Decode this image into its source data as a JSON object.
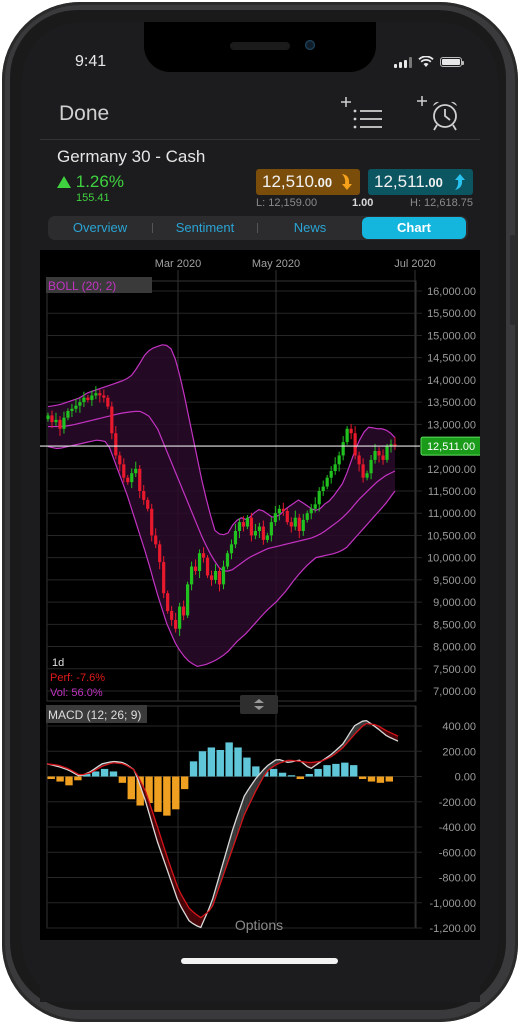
{
  "status_bar": {
    "time": "9:41"
  },
  "nav": {
    "done_label": "Done",
    "icons": [
      "add-to-watchlist-icon",
      "add-alert-icon"
    ]
  },
  "instrument": {
    "name": "Germany 30 - Cash",
    "change_percent": "1.26%",
    "change_direction": "up",
    "change_points": "155.41",
    "sell": {
      "main": "12,510",
      "decimals": ".00",
      "direction": "down"
    },
    "buy": {
      "main": "12,511",
      "decimals": ".00",
      "direction": "up"
    },
    "low": "L: 12,159.00",
    "spread": "1.00",
    "high": "H: 12,618.75"
  },
  "tabs": [
    {
      "label": "Overview",
      "active": false
    },
    {
      "label": "Sentiment",
      "active": false
    },
    {
      "label": "News",
      "active": false
    },
    {
      "label": "Chart",
      "active": true
    }
  ],
  "colors": {
    "up": "#21c21f",
    "down": "#e8192c",
    "boll": "#c233c2",
    "macd_line": "#d9d9d9",
    "signal_line": "#d4141b",
    "hist_pos": "#5fc7d8",
    "hist_neg": "#f0a020",
    "current_price_bg": "#1a9c1a",
    "tab_active": "#15b6de",
    "sell_bg": "#7a4d0b",
    "buy_bg": "#0c5662"
  },
  "chart": {
    "indicator_label": "BOLL (20; 2)",
    "interval": "1d",
    "perf": "Perf: -7.6%",
    "vol": "Vol: 56.0%",
    "current_price_label": "12,511.00",
    "macd_label": "MACD (12; 26; 9)",
    "options_label": "Options"
  },
  "chart_data": [
    {
      "type": "candlestick",
      "title": "Germany 30 - Cash",
      "indicator": "BOLL (20; 2)",
      "interval": "1d",
      "x_ticks": [
        "Mar 2020",
        "May 2020",
        "Jul 2020"
      ],
      "y_ticks": [
        "16,000.00",
        "15,500.00",
        "15,000.00",
        "14,500.00",
        "14,000.00",
        "13,500.00",
        "13,000.00",
        "12,000.00",
        "11,500.00",
        "11,000.00",
        "10,500.00",
        "10,000.00",
        "9,500.00",
        "9,000.00",
        "8,500.00",
        "8,000.00",
        "7,500.00",
        "7,000.00"
      ],
      "ylim": [
        7000,
        16000
      ],
      "current_price": 12511,
      "close": [
        13200,
        13050,
        13100,
        12900,
        13150,
        13300,
        13350,
        13420,
        13500,
        13600,
        13550,
        13650,
        13700,
        13650,
        13600,
        13400,
        12800,
        12300,
        12100,
        11800,
        11700,
        11900,
        12000,
        11500,
        11300,
        11100,
        10500,
        10300,
        9900,
        9200,
        8800,
        8600,
        8400,
        8900,
        8700,
        9400,
        9800,
        9700,
        10100,
        10000,
        9600,
        9500,
        9700,
        9400,
        9800,
        10100,
        10300,
        10600,
        10800,
        10700,
        10900,
        10500,
        10600,
        10700,
        10400,
        10500,
        10800,
        11000,
        11100,
        11050,
        10800,
        10700,
        10900,
        10600,
        10850,
        11000,
        11100,
        11200,
        11500,
        11600,
        11800,
        11950,
        12100,
        12300,
        12600,
        12900,
        12800,
        12300,
        12100,
        11800,
        11900,
        12200,
        12400,
        12300,
        12200,
        12500,
        12550,
        12511
      ],
      "boll_upper": [
        13400,
        13420,
        13450,
        13500,
        13550,
        13600,
        13700,
        13750,
        13800,
        13850,
        13900,
        13950,
        14000,
        14100,
        14300,
        14550,
        14700,
        14750,
        14800,
        14750,
        14400,
        13800,
        13100,
        12400,
        11700,
        11100,
        10600,
        10500,
        10550,
        10800,
        10900,
        10850,
        11000,
        11100,
        11000,
        10900,
        10950,
        11100,
        11200,
        11300,
        11200,
        11100,
        11050,
        11200,
        11300,
        11500,
        11700,
        12100,
        12500,
        12800,
        12950,
        12900,
        12900,
        12850,
        12700
      ],
      "boll_middle": [
        12950,
        12950,
        12960,
        13000,
        13050,
        13100,
        13150,
        13200,
        13250,
        13280,
        13300,
        13200,
        12900,
        12400,
        11900,
        11400,
        10900,
        10400,
        10000,
        9700,
        9700,
        9850,
        10000,
        10100,
        10200,
        10250,
        10300,
        10350,
        10400,
        10450,
        10550,
        10700,
        10850,
        11050,
        11300,
        11500,
        11700,
        11850,
        11950
      ],
      "boll_lower": [
        12500,
        12450,
        12500,
        12550,
        12600,
        12650,
        12600,
        12000,
        11400,
        10700,
        10000,
        9200,
        8500,
        8000,
        7700,
        7550,
        7600,
        7700,
        7850,
        8100,
        8300,
        8550,
        8800,
        9000,
        9250,
        9550,
        9800,
        10000,
        10050,
        10100,
        10200,
        10450,
        10700,
        10950,
        11200,
        11500
      ]
    },
    {
      "type": "line",
      "title": "MACD (12; 26; 9)",
      "y_ticks": [
        "400.00",
        "200.00",
        "0.00",
        "-200.00",
        "-400.00",
        "-600.00",
        "-800.00",
        "-1,000.00",
        "-1,200.00"
      ],
      "ylim": [
        -1200,
        400
      ],
      "series": [
        {
          "name": "MACD",
          "values": [
            100,
            80,
            50,
            0,
            40,
            100,
            120,
            110,
            50,
            -200,
            -500,
            -750,
            -1000,
            -1150,
            -1200,
            -1000,
            -700,
            -400,
            -150,
            -20,
            80,
            140,
            110,
            130,
            60,
            120,
            180,
            260,
            400,
            450,
            390,
            320,
            280
          ]
        },
        {
          "name": "Signal",
          "values": [
            100,
            90,
            60,
            10,
            30,
            80,
            110,
            100,
            50,
            -120,
            -380,
            -650,
            -900,
            -1050,
            -1120,
            -1050,
            -800,
            -550,
            -300,
            -120,
            40,
            100,
            130,
            120,
            110,
            120,
            160,
            230,
            330,
            420,
            410,
            360,
            320
          ]
        },
        {
          "name": "Histogram",
          "values": [
            -20,
            -40,
            -70,
            -30,
            20,
            40,
            60,
            40,
            -50,
            -180,
            -230,
            -210,
            -280,
            -310,
            -260,
            -100,
            120,
            200,
            230,
            210,
            270,
            230,
            150,
            80,
            40,
            60,
            30,
            10,
            -20,
            20,
            60,
            90,
            100,
            110,
            90,
            -20,
            -40,
            -50,
            -40
          ]
        }
      ]
    }
  ]
}
